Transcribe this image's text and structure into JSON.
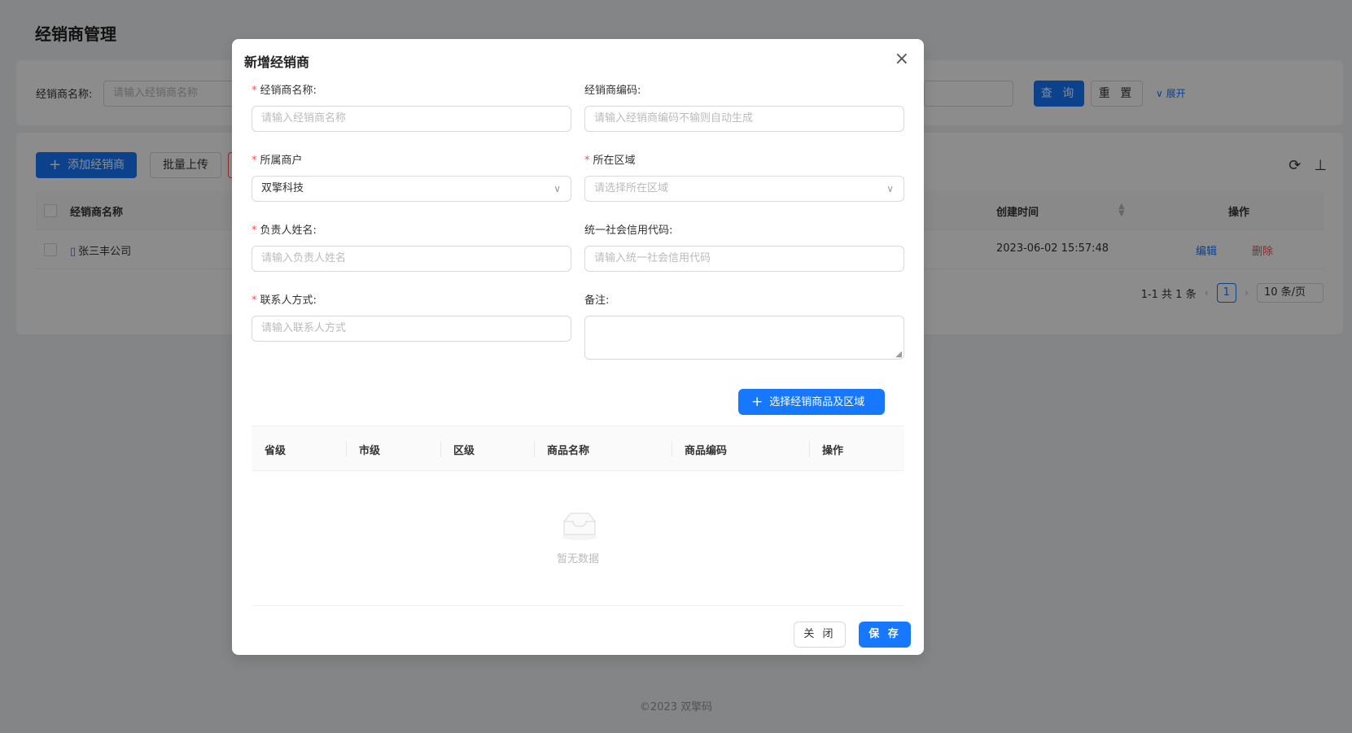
{
  "page": {
    "title": "经销商管理",
    "footer": "©2023 双擎码"
  },
  "search": {
    "label": "经销商名称:",
    "placeholder": "请输入经销商名称",
    "query_label": "查 询",
    "reset_label": "重 置",
    "expand_label": "∨ 展开"
  },
  "toolbar": {
    "add_label": "添加经销商",
    "upload_label": "批量上传"
  },
  "table": {
    "columns": [
      "经销商名称",
      "创建时间",
      "操作"
    ],
    "rows": [
      {
        "name": "张三丰公司",
        "created": "2023-06-02 15:57:48",
        "edit": "编辑",
        "delete": "删除"
      }
    ]
  },
  "pagination": {
    "summary": "1-1 共 1 条",
    "current_page": "1",
    "page_size": "10 条/页"
  },
  "modal": {
    "title": "新增经销商",
    "fields": {
      "name": {
        "label": "经销商名称:",
        "placeholder": "请输入经销商名称",
        "required": true
      },
      "code": {
        "label": "经销商编码:",
        "placeholder": "请输入经销商编码不输则自动生成",
        "required": false
      },
      "merchant": {
        "label": "所属商户",
        "value": "双擎科技",
        "required": true
      },
      "region": {
        "label": "所在区域",
        "placeholder": "请选择所在区域",
        "required": true
      },
      "owner": {
        "label": "负责人姓名:",
        "placeholder": "请输入负责人姓名",
        "required": true
      },
      "credit_code": {
        "label": "统一社会信用代码:",
        "placeholder": "请输入统一社会信用代码",
        "required": false
      },
      "contact": {
        "label": "联系人方式:",
        "placeholder": "请输入联系人方式",
        "required": true
      },
      "remark": {
        "label": "备注:",
        "required": false
      }
    },
    "select_button": "选择经销商品及区域",
    "inner_table": {
      "columns": [
        "省级",
        "市级",
        "区级",
        "商品名称",
        "商品编码",
        "操作"
      ],
      "empty_text": "暂无数据"
    },
    "close_label": "关 闭",
    "save_label": "保 存"
  },
  "colors": {
    "primary": "#1677ff",
    "danger": "#ff4d4f",
    "mask": "rgba(0,0,0,0.45)"
  }
}
